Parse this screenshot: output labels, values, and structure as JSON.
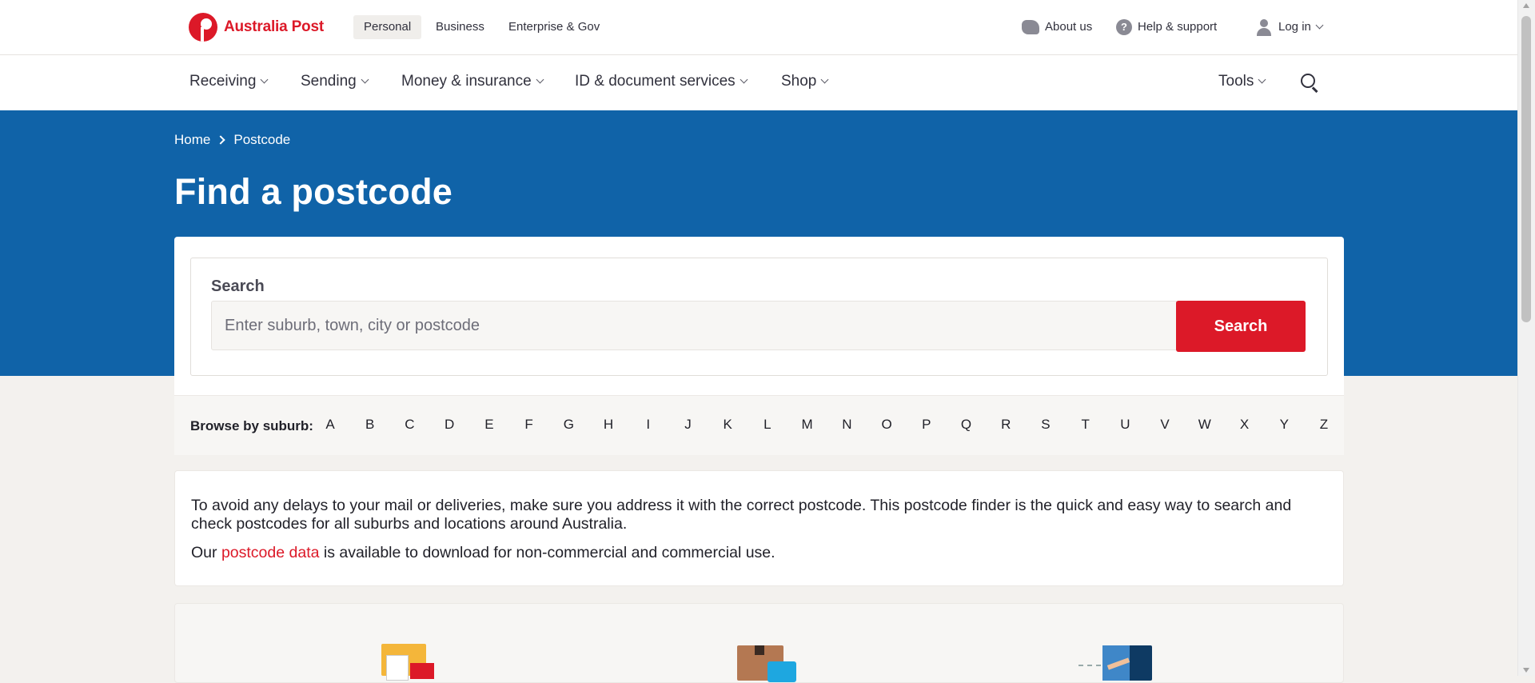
{
  "brand": {
    "name": "Australia Post",
    "color": "#dc1928"
  },
  "topbar": {
    "segments": [
      "Personal",
      "Business",
      "Enterprise & Gov"
    ],
    "active_segment": "Personal",
    "about": "About us",
    "help": "Help & support",
    "login": "Log in"
  },
  "mainnav": {
    "items": [
      "Receiving",
      "Sending",
      "Money & insurance",
      "ID & document services",
      "Shop"
    ],
    "tools": "Tools"
  },
  "breadcrumb": [
    "Home",
    "Postcode"
  ],
  "page_title": "Find a postcode",
  "search": {
    "label": "Search",
    "placeholder": "Enter suburb, town, city or postcode",
    "button": "Search"
  },
  "browse": {
    "label": "Browse by suburb:",
    "letters": [
      "A",
      "B",
      "C",
      "D",
      "E",
      "F",
      "G",
      "H",
      "I",
      "J",
      "K",
      "L",
      "M",
      "N",
      "O",
      "P",
      "Q",
      "R",
      "S",
      "T",
      "U",
      "V",
      "W",
      "X",
      "Y",
      "Z"
    ]
  },
  "info": {
    "paragraph1": "To avoid any delays to your mail or deliveries, make sure you address it with the correct postcode. This postcode finder is the quick and easy way to search and check postcodes for all suburbs and locations around Australia.",
    "p2_prefix": "Our ",
    "p2_link": "postcode data",
    "p2_suffix": " is available to download for non-commercial and commercial use."
  },
  "colors": {
    "hero": "#1063a8",
    "accent": "#dc1928",
    "page_bg": "#f3f1ee"
  }
}
